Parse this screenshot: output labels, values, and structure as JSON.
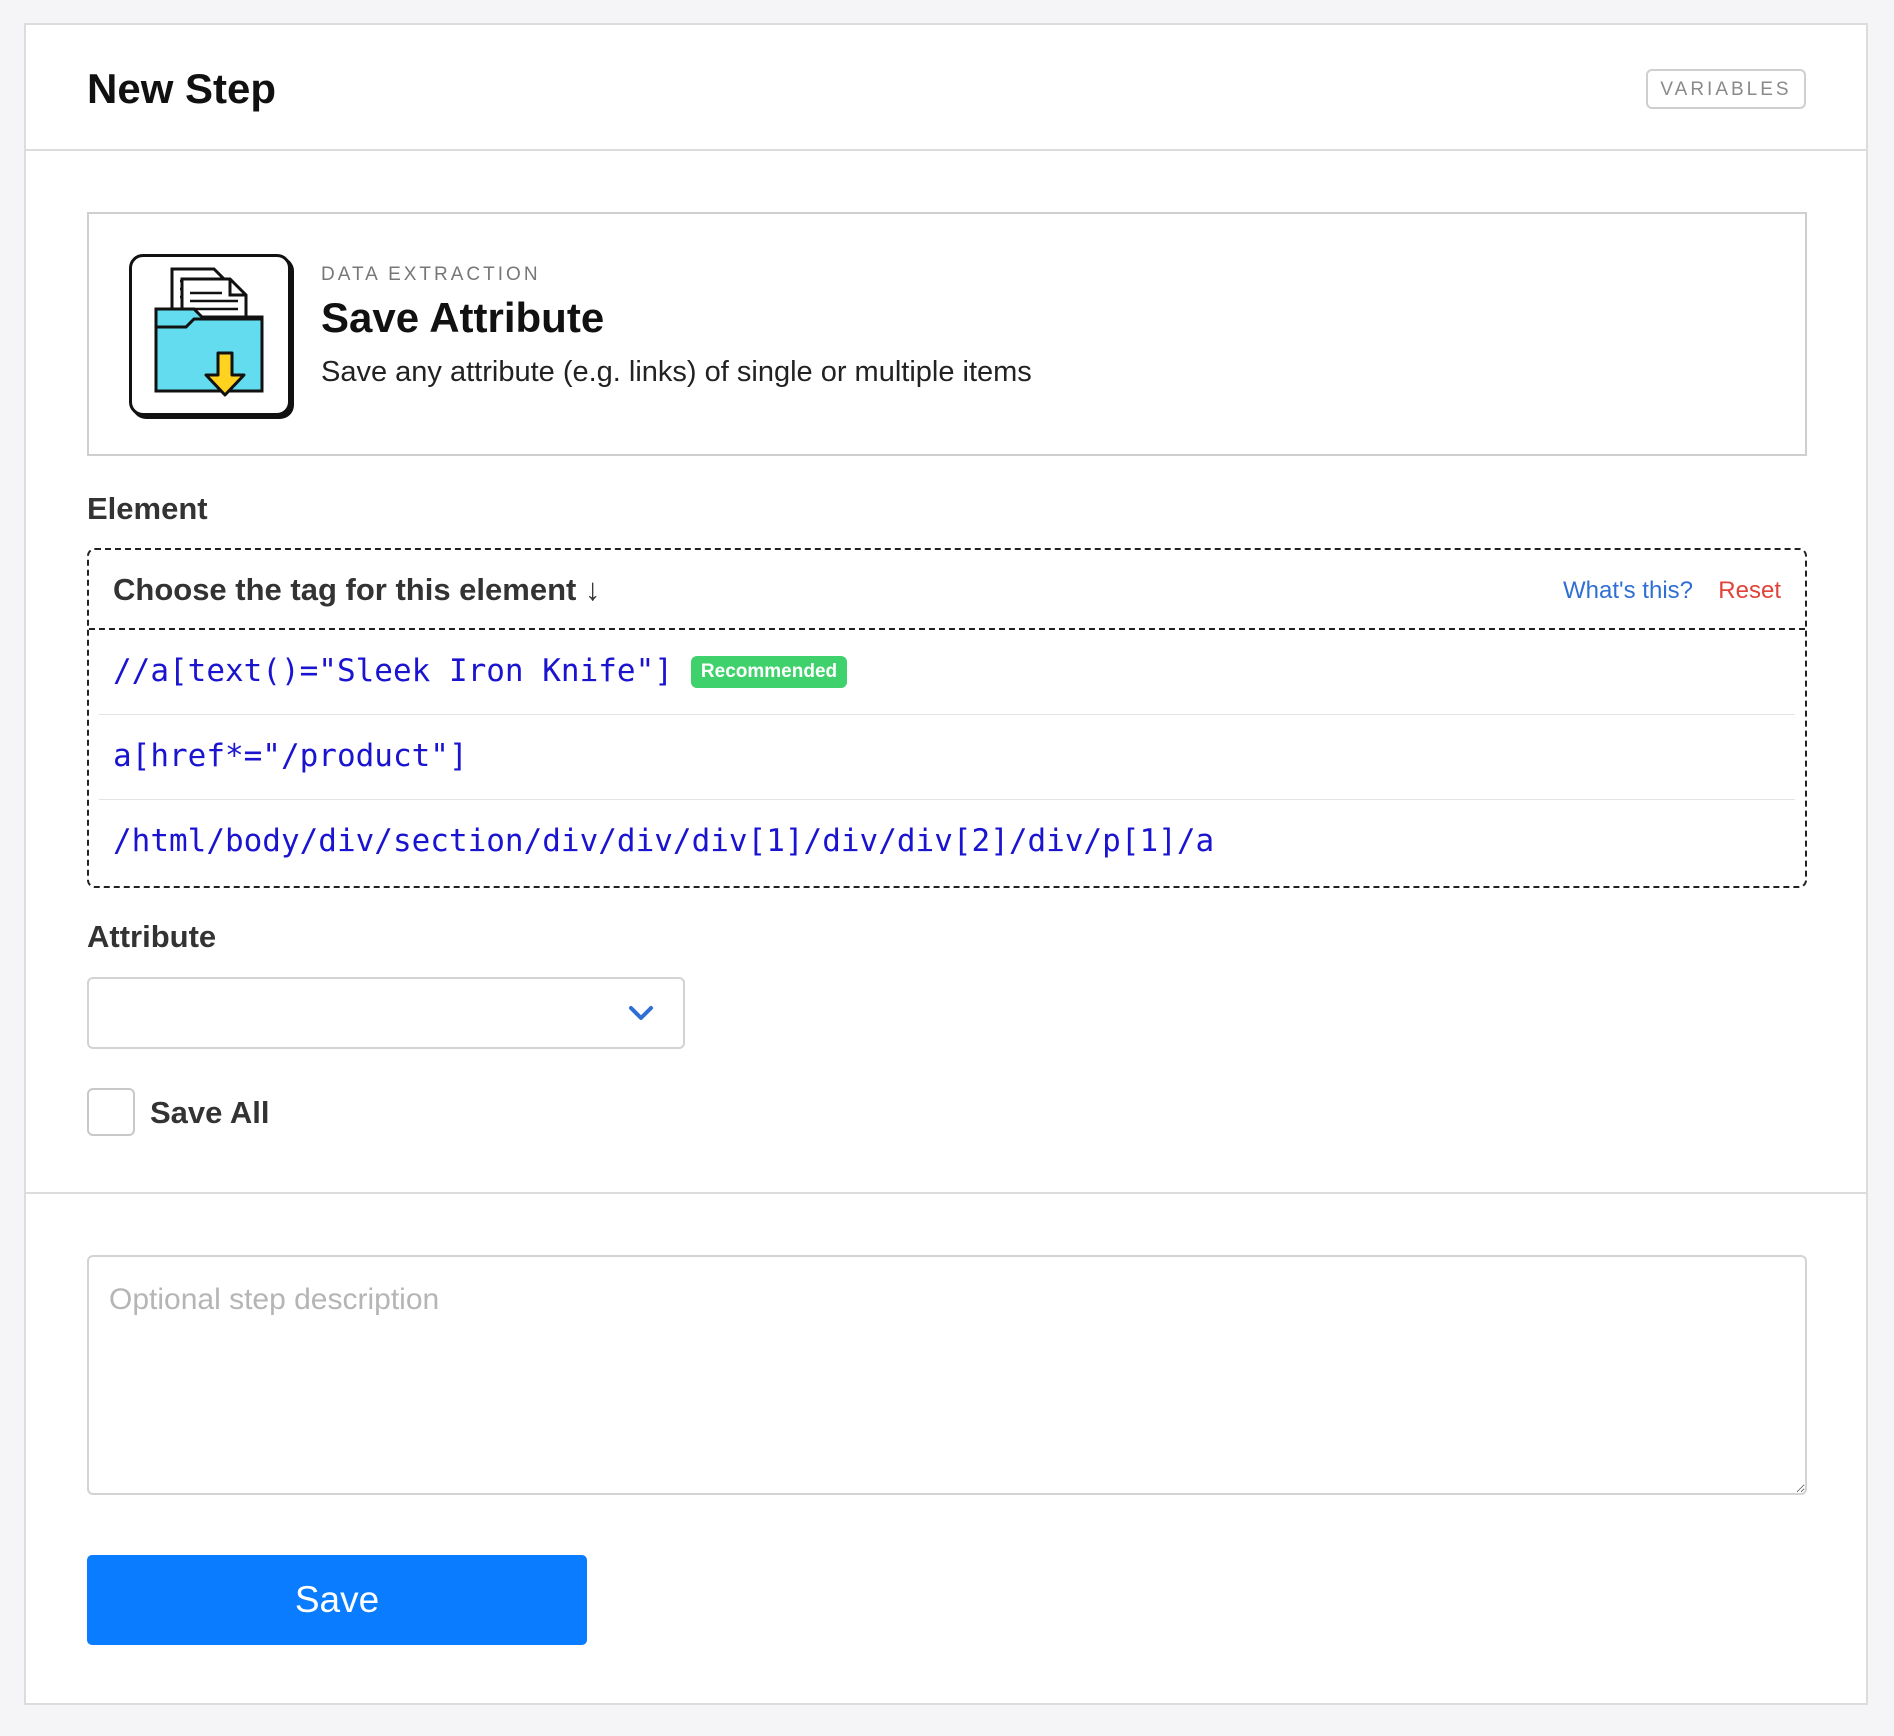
{
  "header": {
    "title": "New Step",
    "variables_label": "VARIABLES"
  },
  "step_card": {
    "icon": "folder-download-icon",
    "category": "DATA EXTRACTION",
    "title": "Save Attribute",
    "description": "Save any attribute (e.g. links) of single or multiple items"
  },
  "element": {
    "label": "Element",
    "chooser_title": "Choose the tag for this element ↓",
    "help_link": "What's this?",
    "reset_link": "Reset",
    "selectors": [
      {
        "value": "//a[text()=\"Sleek Iron Knife\"]",
        "badge": "Recommended"
      },
      {
        "value": "a[href*=\"/product\"]",
        "badge": ""
      },
      {
        "value": "/html/body/div/section/div/div/div[1]/div/div[2]/div/p[1]/a",
        "badge": ""
      }
    ]
  },
  "attribute": {
    "label": "Attribute",
    "selected_value": ""
  },
  "save_all": {
    "label": "Save All",
    "checked": false
  },
  "description_field": {
    "placeholder": "Optional step description",
    "value": ""
  },
  "save_button_label": "Save",
  "colors": {
    "accent": "#0a7cff",
    "link": "#2f6fd3",
    "reset": "#e0433a",
    "selector_text": "#1a14d0",
    "badge": "#3fd16b"
  }
}
